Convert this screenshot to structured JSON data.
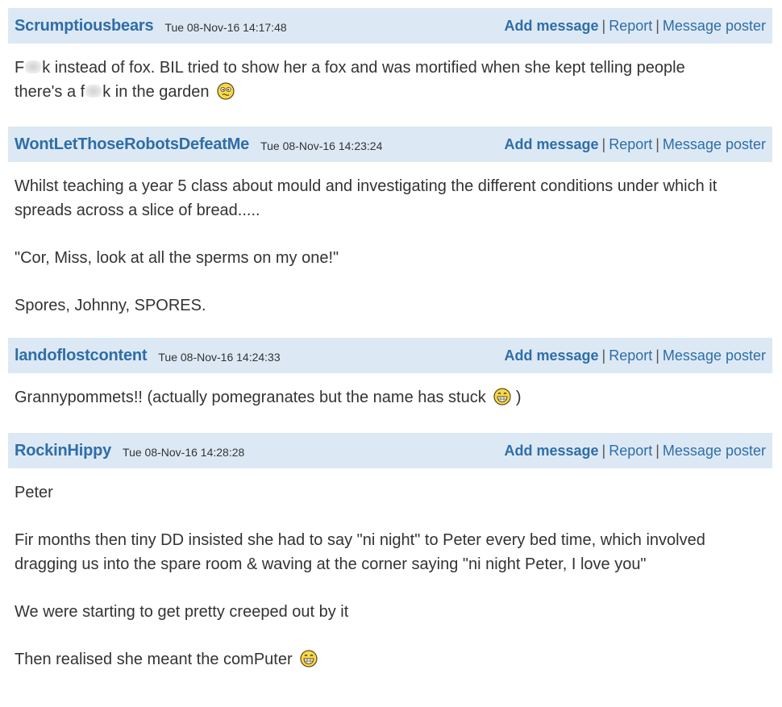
{
  "actions": {
    "add_message": "Add message",
    "separator": "|",
    "report": "Report",
    "message_poster": "Message poster"
  },
  "posts": [
    {
      "poster": "Scrumptiousbears",
      "timestamp": "Tue 08-Nov-16 14:17:48",
      "line1_a": "F",
      "line1_b": "k instead of fox. BIL tried to show her a fox and was mortified when she kept telling people",
      "line2_a": "there's a f",
      "line2_b": "k in the garden",
      "emoji": "confused-face-icon"
    },
    {
      "poster": "WontLetThoseRobotsDefeatMe",
      "timestamp": "Tue 08-Nov-16 14:23:24",
      "paragraphs": [
        "Whilst teaching a year 5 class about mould and investigating the different conditions under which it spreads across a slice of bread.....",
        "\"Cor, Miss, look at all the sperms on my one!\"",
        "Spores, Johnny, SPORES."
      ]
    },
    {
      "poster": "landoflostcontent",
      "timestamp": "Tue 08-Nov-16 14:24:33",
      "text_a": "Grannypommets!! (actually pomegranates but the name has stuck",
      "text_b": ")",
      "emoji": "grinning-face-icon"
    },
    {
      "poster": "RockinHippy",
      "timestamp": "Tue 08-Nov-16 14:28:28",
      "paragraphs": [
        "Peter",
        "Fir months then tiny DD insisted she had to say \"ni night\" to Peter every bed time, which involved dragging us into the spare room & waving at the corner saying \"ni night Peter, I love you\"",
        "We were starting to get pretty creeped out by it"
      ],
      "last_line": "Then realised she meant the comPuter",
      "emoji": "grinning-face-icon"
    }
  ],
  "colors": {
    "header_bg": "#dce9f5",
    "link": "#2f6da7",
    "body_text": "#333333"
  }
}
